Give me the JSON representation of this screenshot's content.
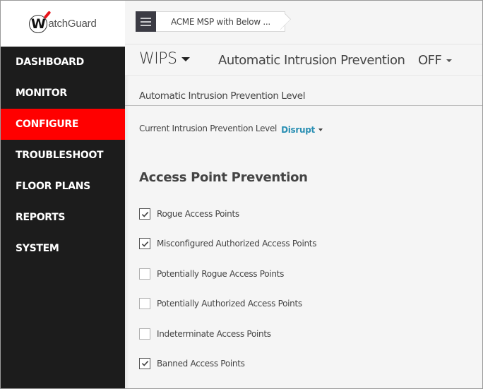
{
  "brand": {
    "logo_text": "atchGuard",
    "logo_mark": "W",
    "accent_color": "#ff0000"
  },
  "sidebar": {
    "items": [
      {
        "label": "DASHBOARD",
        "active": false
      },
      {
        "label": "MONITOR",
        "active": false
      },
      {
        "label": "CONFIGURE",
        "active": true
      },
      {
        "label": "TROUBLESHOOT",
        "active": false
      },
      {
        "label": "FLOOR PLANS",
        "active": false
      },
      {
        "label": "REPORTS",
        "active": false
      },
      {
        "label": "SYSTEM",
        "active": false
      }
    ]
  },
  "topbar": {
    "menu_icon": "hamburger-icon",
    "breadcrumb": "ACME MSP with Below ..."
  },
  "header": {
    "section_dropdown": "WIPS",
    "feature_title": "Automatic Intrusion Prevention",
    "toggle_value": "OFF"
  },
  "level": {
    "heading": "Automatic Intrusion Prevention Level",
    "current_label": "Current Intrusion Prevention Level",
    "current_value": "Disrupt",
    "value_color": "#2a8fb3"
  },
  "prevention": {
    "title": "Access Point Prevention",
    "items": [
      {
        "label": "Rogue Access Points",
        "checked": true
      },
      {
        "label": "Misconfigured Authorized Access Points",
        "checked": true
      },
      {
        "label": "Potentially Rogue Access Points",
        "checked": false
      },
      {
        "label": "Potentially Authorized Access Points",
        "checked": false
      },
      {
        "label": "Indeterminate Access Points",
        "checked": false
      },
      {
        "label": "Banned Access Points",
        "checked": true
      }
    ]
  }
}
